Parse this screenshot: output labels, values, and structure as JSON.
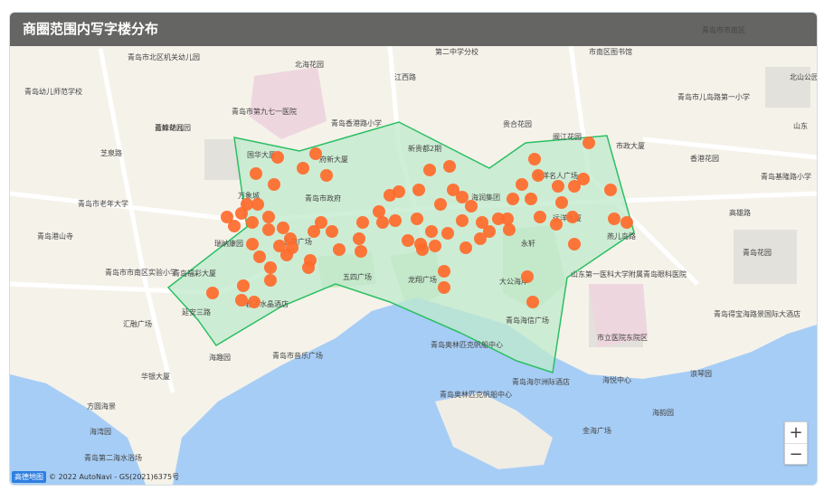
{
  "title": "商圈范围内写字楼分布",
  "zoom": {
    "in_label": "+",
    "out_label": "−"
  },
  "attribution": {
    "logo": "高德地图",
    "text": "© 2022 AutoNavi - GS(2021)6375号"
  },
  "colors": {
    "region_fill": "#bfe9cc",
    "region_stroke": "#2bbf63",
    "marker": "#ff6a2b",
    "water": "#a6cdf5",
    "land": "#f5f2ea"
  },
  "map_labels": [
    "青岛市北区机关幼儿园",
    "北海花园",
    "江西路",
    "第二中学分校",
    "市南区图书馆",
    "青岛市市南区",
    "北山公园",
    "青岛幼儿师范学校",
    "青岛市第九七一医院",
    "青岛香港路小学",
    "青峰花园",
    "青岛市儿岛路第一小学",
    "蓝鲸幼儿园",
    "贵合花园",
    "闽江花园",
    "市政大厦",
    "山东",
    "芝泉路",
    "国华大厦",
    "府新大厦",
    "新贵都2期",
    "香港花园",
    "青岛基隆路小学",
    "青岛市老年大学",
    "万象城",
    "青岛市政府",
    "海润集团",
    "远洋名人广场",
    "高雄路",
    "远洋大厦",
    "燕儿岛路",
    "青岛港山寺",
    "瑞纳康园",
    "五四广场",
    "永轩",
    "青岛花园",
    "青岛市市南区实验小学",
    "青岛福彩大厦",
    "五四广场",
    "龙翔广场",
    "大公海岸",
    "山东第一医科大学附属青岛眼科医院",
    "延安三路",
    "君子水晶酒店",
    "汇融广场",
    "青岛得宝海路景国际大酒店",
    "海趣园",
    "青岛市音乐广场",
    "青岛海信广场",
    "市立医院东院区",
    "青岛奥林匹克帆船中心",
    "华银大厦",
    "青岛海尔洲际酒店",
    "海悦中心",
    "浪琴园",
    "方圆海景",
    "青岛奥林匹克帆船中心",
    "海湾园",
    "青岛第二海水浴场",
    "金海广场",
    "海韵园"
  ],
  "markers": {
    "count": 84
  }
}
